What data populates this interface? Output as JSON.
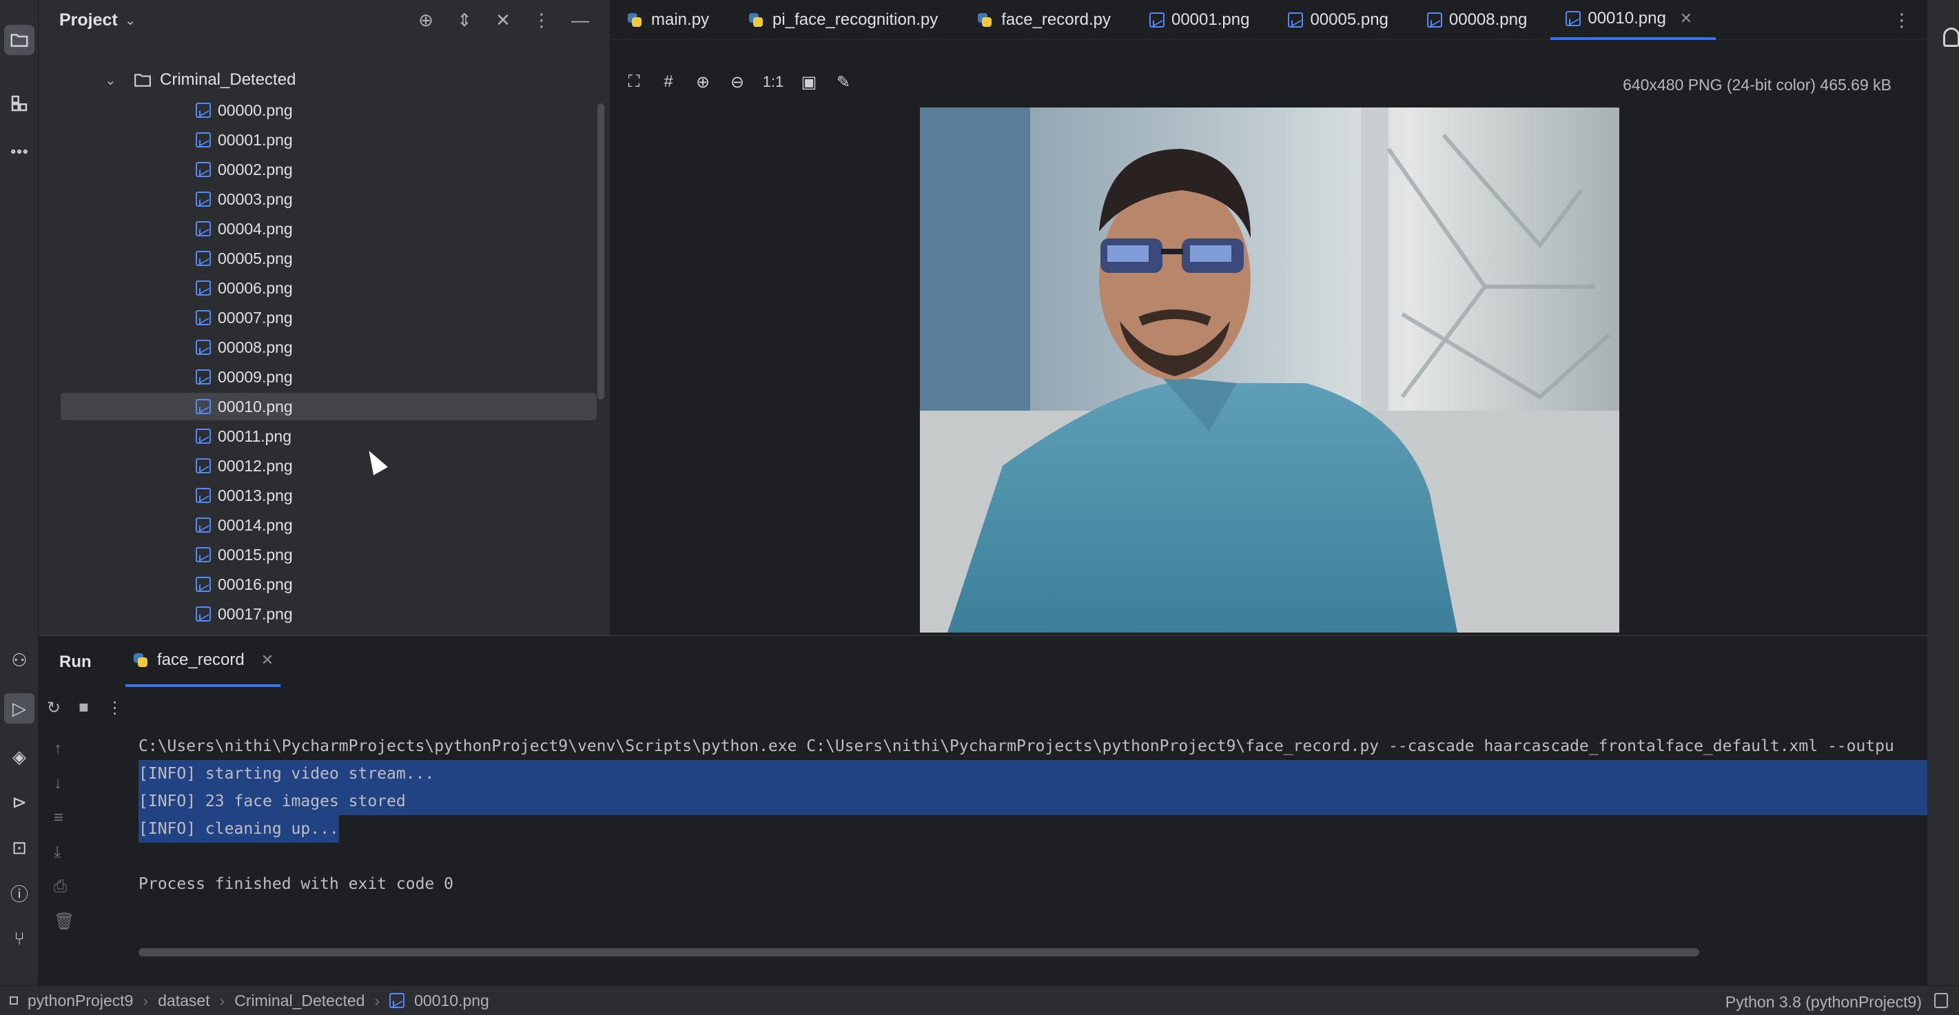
{
  "project_panel": {
    "title": "Project",
    "folder": "Criminal_Detected",
    "files": [
      "00000.png",
      "00001.png",
      "00002.png",
      "00003.png",
      "00004.png",
      "00005.png",
      "00006.png",
      "00007.png",
      "00008.png",
      "00009.png",
      "00010.png",
      "00011.png",
      "00012.png",
      "00013.png",
      "00014.png",
      "00015.png",
      "00016.png",
      "00017.png"
    ],
    "selected_index": 10
  },
  "tabs": [
    {
      "label": "main.py",
      "icon": "python-file-icon"
    },
    {
      "label": "pi_face_recognition.py",
      "icon": "python-file-icon"
    },
    {
      "label": "face_record.py",
      "icon": "python-file-icon"
    },
    {
      "label": "00001.png",
      "icon": "image-file-icon"
    },
    {
      "label": "00005.png",
      "icon": "image-file-icon"
    },
    {
      "label": "00008.png",
      "icon": "image-file-icon"
    },
    {
      "label": "00010.png",
      "icon": "image-file-icon",
      "active": true
    }
  ],
  "image_viewer": {
    "info": "640x480 PNG (24-bit color) 465.69 kB",
    "zoom_label": "1:1"
  },
  "run_panel": {
    "title": "Run",
    "tab_label": "face_record",
    "console": [
      "C:\\Users\\nithi\\PycharmProjects\\pythonProject9\\venv\\Scripts\\python.exe C:\\Users\\nithi\\PycharmProjects\\pythonProject9\\face_record.py --cascade haarcascade_frontalface_default.xml --outpu",
      "[INFO] starting video stream...",
      "[INFO] 23 face images stored",
      "[INFO] cleaning up...",
      "",
      "Process finished with exit code 0"
    ]
  },
  "status_bar": {
    "breadcrumbs": [
      "pythonProject9",
      "dataset",
      "Criminal_Detected",
      "00010.png"
    ],
    "interpreter": "Python 3.8 (pythonProject9)"
  },
  "colors": {
    "accent": "#3574f0",
    "selection": "#214283",
    "panel_bg": "#2b2d30",
    "editor_bg": "#1e1f22",
    "file_icon": "#548af7"
  }
}
